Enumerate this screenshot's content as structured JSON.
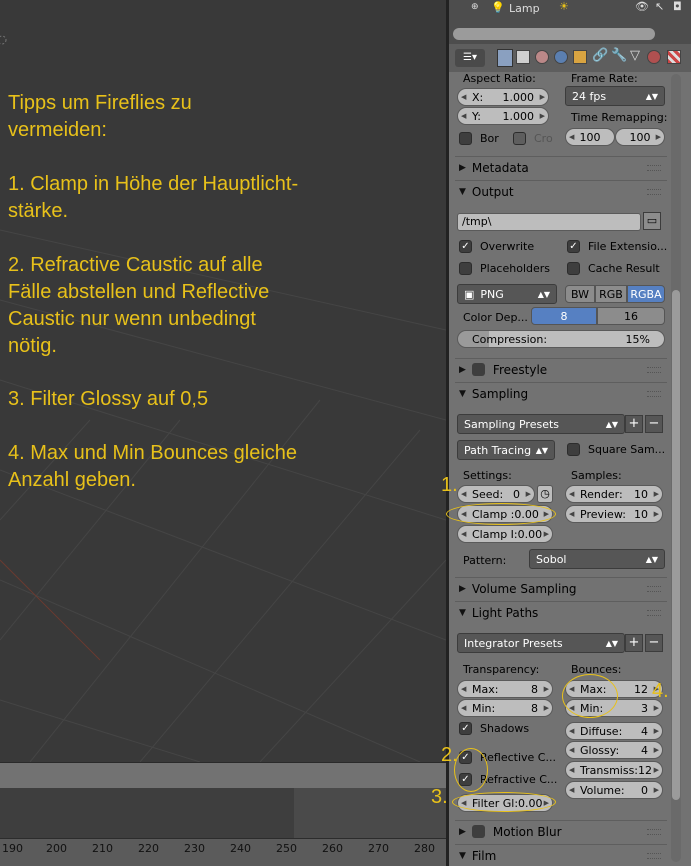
{
  "tips": {
    "heading_1": "Tipps um Fireflies zu",
    "heading_2": "vermeiden:",
    "tip1_line1": "1. Clamp in Höhe der Hauptlicht-",
    "tip1_line2": "stärke.",
    "tip2_line1": "2. Refractive Caustic auf alle",
    "tip2_line2": "Fälle abstellen und Reflective",
    "tip2_line3": "Caustic nur wenn unbedingt",
    "tip2_line4": "nötig.",
    "tip3": "3. Filter Glossy auf 0,5",
    "tip4_line1": "4. Max und Min Bounces gleiche",
    "tip4_line2": "Anzahl geben.",
    "color": "#e8c11a"
  },
  "annotations": {
    "a1": "1.",
    "a2": "2.",
    "a3": "3.",
    "a4": "4."
  },
  "timeline": {
    "ticks": [
      "190",
      "200",
      "210",
      "220",
      "230",
      "240",
      "250",
      "260",
      "270",
      "280"
    ]
  },
  "outliner": {
    "item": "Lamp"
  },
  "properties": {
    "aspect_ratio_label": "Aspect Ratio:",
    "frame_rate_label": "Frame Rate:",
    "x_label": "X:",
    "x_value": "1.000",
    "y_label": "Y:",
    "y_value": "1.000",
    "frame_rate": "24 fps",
    "time_remapping_label": "Time Remapping:",
    "remap_old": "100",
    "remap_new": "100",
    "border_label": "Bor",
    "crop_label": "Cro",
    "metadata": "Metadata",
    "output": "Output",
    "output_path": "/tmp\\",
    "overwrite": "Overwrite",
    "file_extensions": "File Extensio...",
    "placeholders": "Placeholders",
    "cache_result": "Cache Result",
    "format": "PNG",
    "bw": "BW",
    "rgb": "RGB",
    "rgba": "RGBA",
    "color_depth_label": "Color Dep...",
    "depth_8": "8",
    "depth_16": "16",
    "compression_label": "Compression:",
    "compression_value": "15%",
    "freestyle": "Freestyle",
    "sampling": "Sampling",
    "sampling_presets": "Sampling Presets",
    "path_tracing": "Path Tracing",
    "square_samples": "Square Sam...",
    "settings_label": "Settings:",
    "samples_label": "Samples:",
    "seed_label": "Seed:",
    "seed_value": "0",
    "render_label": "Render:",
    "render_value": "10",
    "clamp_label": "Clamp :",
    "clamp_value": "0.00",
    "preview_label": "Preview:",
    "preview_value": "10",
    "clamp_indirect_label": "Clamp I:",
    "clamp_indirect_value": "0.00",
    "pattern_label": "Pattern:",
    "pattern_value": "Sobol",
    "volume_sampling": "Volume Sampling",
    "light_paths": "Light Paths",
    "integrator_presets": "Integrator Presets",
    "transparency_label": "Transparency:",
    "bounces_label": "Bounces:",
    "t_max_label": "Max:",
    "t_max_value": "8",
    "t_min_label": "Min:",
    "t_min_value": "8",
    "b_max_label": "Max:",
    "b_max_value": "12",
    "b_min_label": "Min:",
    "b_min_value": "3",
    "shadows": "Shadows",
    "diffuse_label": "Diffuse:",
    "diffuse_value": "4",
    "glossy_label": "Glossy:",
    "glossy_value": "4",
    "reflective_caustics": "Reflective C...",
    "refractive_caustics": "Refractive C...",
    "transmission_label": "Transmiss:",
    "transmission_value": "12",
    "volume_label": "Volume:",
    "volume_value": "0",
    "filter_glossy_label": "Filter Gl:",
    "filter_glossy_value": "0.00",
    "motion_blur": "Motion Blur",
    "film": "Film"
  }
}
